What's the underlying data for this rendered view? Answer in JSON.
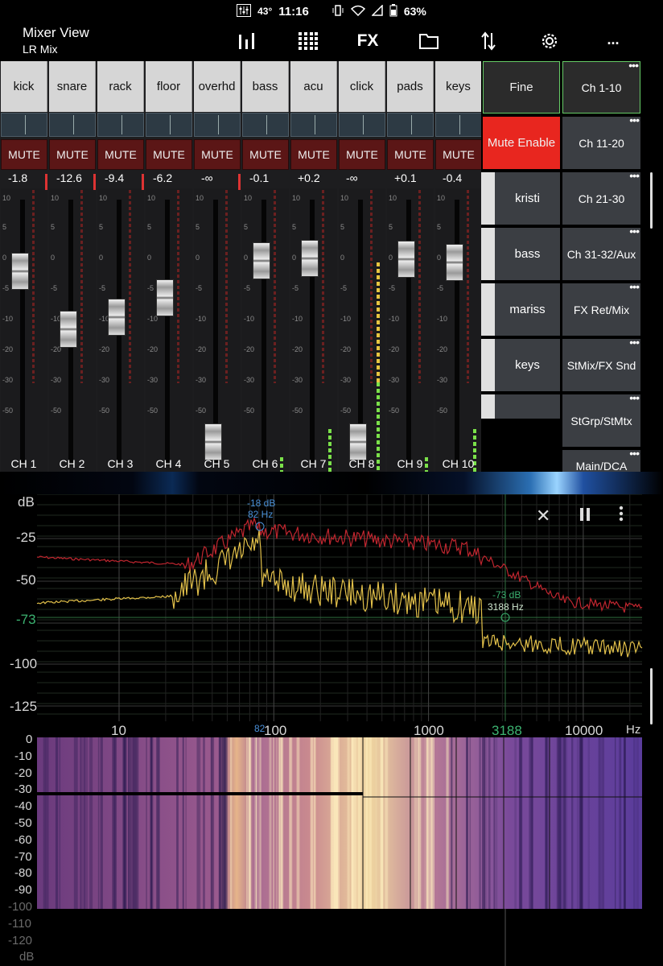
{
  "status_bar": {
    "temperature": "43°",
    "time": "11:16",
    "battery": "63%"
  },
  "app": {
    "title": "Mixer View",
    "subtitle": "LR Mix",
    "toolbar": {
      "fx_label": "FX",
      "more_label": "..."
    }
  },
  "channels": [
    {
      "name": "kick",
      "mute_label": "MUTE",
      "db": "-1.8",
      "label": "CH 1",
      "fader_db": -1.8,
      "meter_level": 0.0
    },
    {
      "name": "snare",
      "mute_label": "MUTE",
      "db": "-12.6",
      "label": "CH 2",
      "fader_db": -12.6,
      "meter_level": 0.0
    },
    {
      "name": "rack",
      "mute_label": "MUTE",
      "db": "-9.4",
      "label": "CH 3",
      "fader_db": -9.4,
      "meter_level": 0.08
    },
    {
      "name": "floor",
      "mute_label": "MUTE",
      "db": "-6.2",
      "label": "CH 4",
      "fader_db": -6.2,
      "meter_level": 0.08
    },
    {
      "name": "overhd",
      "mute_label": "MUTE",
      "db": "-∞",
      "label": "CH 5",
      "fader_db": -90,
      "meter_level": 0.03
    },
    {
      "name": "bass",
      "mute_label": "MUTE",
      "db": "-0.1",
      "label": "CH 6",
      "fader_db": -0.1,
      "meter_level": 0.2
    },
    {
      "name": "acu",
      "mute_label": "MUTE",
      "db": "+0.2",
      "label": "CH 7",
      "fader_db": 0.2,
      "meter_level": 0.28
    },
    {
      "name": "click",
      "mute_label": "MUTE",
      "db": "-∞",
      "label": "CH 8",
      "fader_db": -90,
      "meter_level": 0.75
    },
    {
      "name": "pads",
      "mute_label": "MUTE",
      "db": "+0.1",
      "label": "CH 9",
      "fader_db": 0.1,
      "meter_level": 0.2
    },
    {
      "name": "keys",
      "mute_label": "MUTE",
      "db": "-0.4",
      "label": "CH 10",
      "fader_db": -0.4,
      "meter_level": 0.28
    }
  ],
  "fader_scale": [
    "10",
    "5",
    "0",
    "-5",
    "-10",
    "-20",
    "-30",
    "-50"
  ],
  "right_panel": {
    "fine_label": "Fine",
    "mute_enable_label": "Mute Enable",
    "dca_buttons": [
      "kristi",
      "bass",
      "mariss",
      "keys"
    ],
    "bank_buttons": [
      "Ch 1-10",
      "Ch 11-20",
      "Ch 21-30",
      "Ch 31-32/Aux",
      "FX Ret/Mix",
      "StMix/FX Snd",
      "StGrp/StMtx",
      "Main/DCA"
    ],
    "selected_bank": "Ch 1-10"
  },
  "analyser": {
    "y_unit": "dB",
    "y_ticks": [
      "-25",
      "-50",
      "-73",
      "-100",
      "-125"
    ],
    "x_ticks": [
      "10",
      "100",
      "1000",
      "10000"
    ],
    "x_unit": "Hz",
    "marker1": {
      "db": "-18 dB",
      "freq": "82 Hz",
      "axis_label": "82"
    },
    "marker2": {
      "db": "-73 dB",
      "freq": "3188 Hz",
      "axis_label": "3188"
    },
    "spectrogram_y_ticks": [
      "0",
      "-10",
      "-20",
      "-30",
      "-40",
      "-50",
      "-60",
      "-70",
      "-80",
      "-90",
      "-100",
      "-110",
      "-120",
      "dB"
    ],
    "colors": {
      "red_trace": "#c0262f",
      "yellow_trace": "#e2c04a",
      "marker1": "#4a90d9",
      "marker2": "#3cb371"
    }
  }
}
